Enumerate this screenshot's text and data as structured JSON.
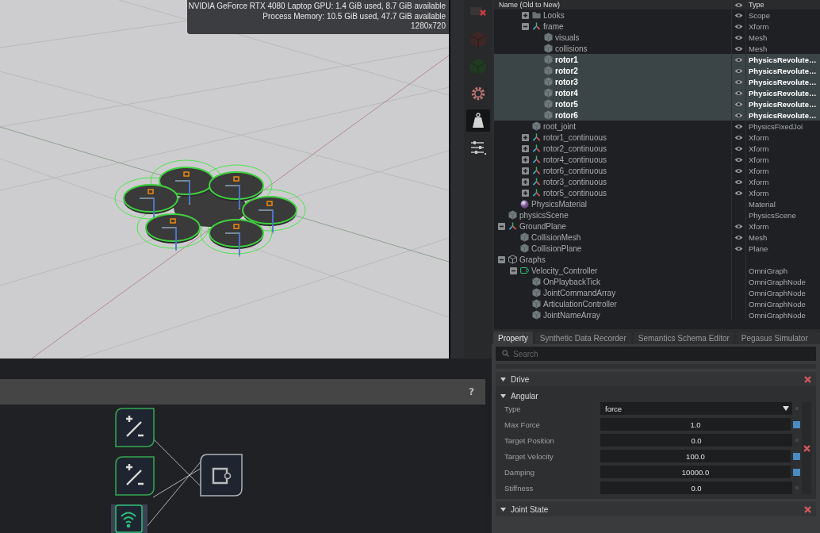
{
  "viewport": {
    "stats": [
      "NVIDIA GeForce RTX 4080 Laptop GPU: 1.4 GiB used, 8.7 GiB available",
      "Process Memory: 10.5 GiB used, 47.7 GiB available",
      "1280x720"
    ]
  },
  "toolbar": [
    {
      "kind": "cube-cross",
      "selected": false
    },
    {
      "kind": "cube-red",
      "selected": false
    },
    {
      "kind": "cube-green",
      "selected": false
    },
    {
      "kind": "gear",
      "selected": false
    },
    {
      "kind": "weight",
      "selected": true
    },
    {
      "kind": "sliders",
      "selected": false
    }
  ],
  "stage": {
    "columns": [
      "Name (Old to New)",
      "Type"
    ],
    "rows": [
      {
        "children": [
          {
            "children": [
              {
                "label": "Looks",
                "kind": "scope",
                "type": "Scope",
                "eye": true,
                "expanded": false,
                "selected": false
              },
              {
                "label": "frame",
                "kind": "xform",
                "type": "Xform",
                "eye": true,
                "expanded": true,
                "selected": false,
                "children": [
                  {
                    "label": "visuals",
                    "kind": "mesh",
                    "type": "Mesh",
                    "eye": true,
                    "selected": false
                  },
                  {
                    "label": "collisions",
                    "kind": "mesh",
                    "type": "Mesh",
                    "eye": true,
                    "selected": false
                  },
                  {
                    "label": "rotor1",
                    "kind": "mesh",
                    "type": "PhysicsRevolute…",
                    "eye": true,
                    "selected": true
                  },
                  {
                    "label": "rotor2",
                    "kind": "mesh",
                    "type": "PhysicsRevolute…",
                    "eye": true,
                    "selected": true
                  },
                  {
                    "label": "rotor3",
                    "kind": "mesh",
                    "type": "PhysicsRevolute…",
                    "eye": true,
                    "selected": true
                  },
                  {
                    "label": "rotor4",
                    "kind": "mesh",
                    "type": "PhysicsRevolute…",
                    "eye": true,
                    "selected": true
                  },
                  {
                    "label": "rotor5",
                    "kind": "mesh",
                    "type": "PhysicsRevolute…",
                    "eye": true,
                    "selected": true
                  },
                  {
                    "label": "rotor6",
                    "kind": "mesh",
                    "type": "PhysicsRevolute…",
                    "eye": true,
                    "selected": true
                  }
                ]
              },
              {
                "label": "root_joint",
                "kind": "mesh",
                "type": "PhysicsFixedJoi",
                "eye": true,
                "selected": false
              },
              {
                "label": "rotor1_continuous",
                "kind": "xform",
                "type": "Xform",
                "eye": true,
                "expanded": false,
                "selected": false
              },
              {
                "label": "rotor2_continuous",
                "kind": "xform",
                "type": "Xform",
                "eye": true,
                "expanded": false,
                "selected": false
              },
              {
                "label": "rotor4_continuous",
                "kind": "xform",
                "type": "Xform",
                "eye": true,
                "expanded": false,
                "selected": false
              },
              {
                "label": "rotor6_continuous",
                "kind": "xform",
                "type": "Xform",
                "eye": true,
                "expanded": false,
                "selected": false
              },
              {
                "label": "rotor3_continuous",
                "kind": "xform",
                "type": "Xform",
                "eye": true,
                "expanded": false,
                "selected": false
              },
              {
                "label": "rotor5_continuous",
                "kind": "xform",
                "type": "Xform",
                "eye": true,
                "expanded": false,
                "selected": false
              }
            ]
          },
          {
            "label": "PhysicsMaterial",
            "kind": "material",
            "type": "Material",
            "eye": false,
            "selected": false
          }
        ]
      },
      {
        "label": "physicsScene",
        "kind": "mesh",
        "type": "PhysicsScene",
        "eye": false,
        "selected": false
      },
      {
        "label": "GroundPlane",
        "kind": "xform",
        "type": "Xform",
        "eye": true,
        "expanded": true,
        "selected": false,
        "children": [
          {
            "label": "CollisionMesh",
            "kind": "mesh",
            "type": "Mesh",
            "eye": true,
            "selected": false
          },
          {
            "label": "CollisionPlane",
            "kind": "mesh",
            "type": "Plane",
            "eye": true,
            "selected": false
          }
        ]
      },
      {
        "label": "Graphs",
        "kind": "graphs",
        "eye": false,
        "expanded": true,
        "selected": false,
        "children": [
          {
            "label": "Velocity_Controller",
            "kind": "graph",
            "type": "OmniGraph",
            "eye": false,
            "expanded": true,
            "selected": false,
            "children": [
              {
                "label": "OnPlaybackTick",
                "kind": "mesh",
                "type": "OmniGraphNode",
                "eye": false,
                "selected": false
              },
              {
                "label": "JointCommandArray",
                "kind": "mesh",
                "type": "OmniGraphNode",
                "eye": false,
                "selected": false
              },
              {
                "label": "ArticulationController",
                "kind": "mesh",
                "type": "OmniGraphNode",
                "eye": false,
                "selected": false
              },
              {
                "label": "JointNameArray",
                "kind": "mesh",
                "type": "OmniGraphNode",
                "eye": false,
                "selected": false
              }
            ]
          }
        ]
      }
    ]
  },
  "property": {
    "tabs": [
      {
        "label": "Property",
        "selected": true
      },
      {
        "label": "Synthetic Data Recorder",
        "selected": false
      },
      {
        "label": "Semantics Schema Editor",
        "selected": false
      },
      {
        "label": "Pegasus Simulator",
        "selected": false
      }
    ],
    "search": {
      "placeholder": "Search"
    },
    "sections": [
      {
        "title": "Drive",
        "expanded": true,
        "groups": [
          {
            "title": "Angular",
            "expanded": true,
            "fields": [
              {
                "kind": "dropdown",
                "label": "Type",
                "value": "force",
                "authored": false
              },
              {
                "kind": "number",
                "label": "Max Force",
                "value": "1.0",
                "authored": true
              },
              {
                "kind": "number",
                "label": "Target Position",
                "value": "0.0",
                "authored": false
              },
              {
                "kind": "number",
                "label": "Target Velocity",
                "value": "100.0",
                "authored": true
              },
              {
                "kind": "number",
                "label": "Damping",
                "value": "10000.0",
                "authored": true
              },
              {
                "kind": "number",
                "label": "Stiffness",
                "value": "0.0",
                "authored": false
              }
            ]
          }
        ]
      },
      {
        "title": "Joint State",
        "expanded": true
      }
    ]
  },
  "graph": {
    "help": "?",
    "nodes": [
      {
        "kind": "math"
      },
      {
        "kind": "math"
      },
      {
        "kind": "tick"
      },
      {
        "kind": "controller"
      }
    ]
  }
}
